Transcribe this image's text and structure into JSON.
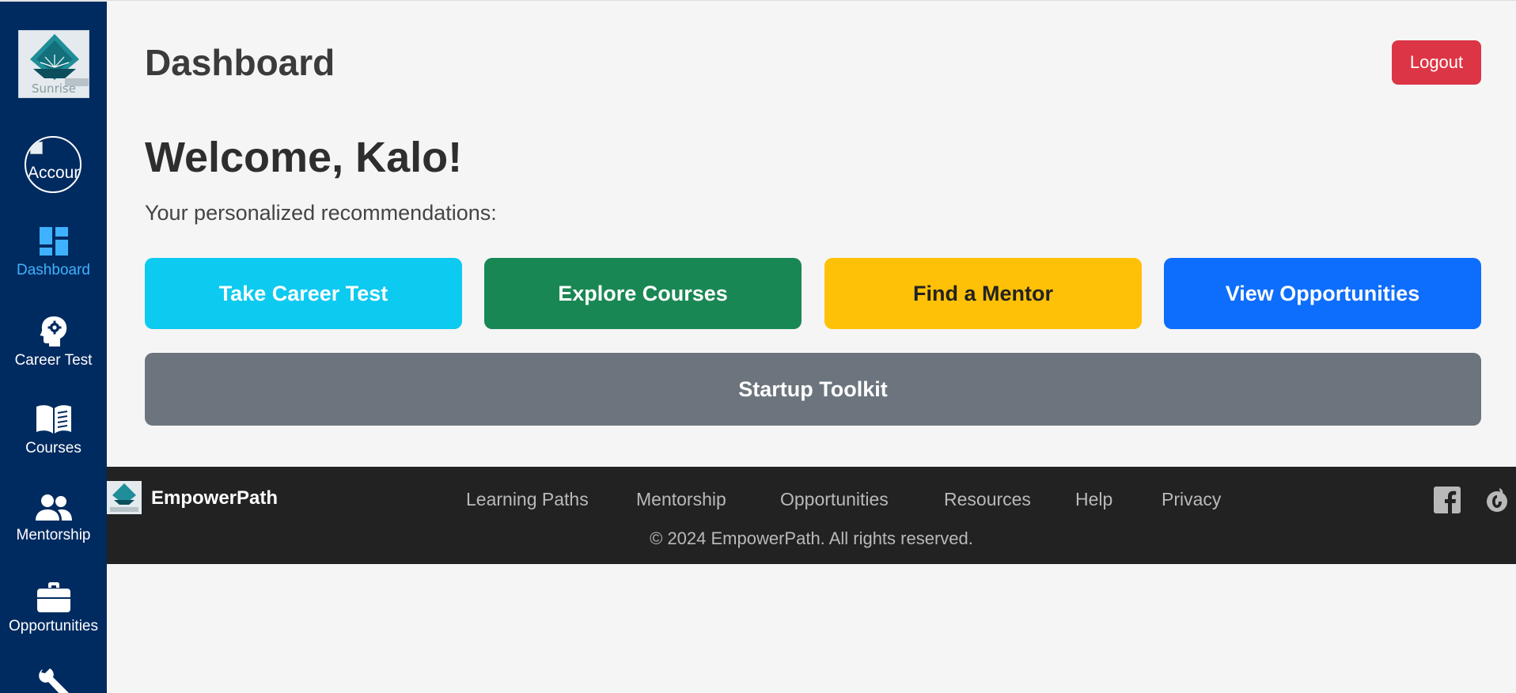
{
  "sidebar": {
    "logo_text": "Sunrise",
    "avatar_alt": "Account",
    "items": [
      {
        "label": "Dashboard",
        "icon": "dashboard-icon",
        "active": true
      },
      {
        "label": "Career Test",
        "icon": "head-gear-icon",
        "active": false
      },
      {
        "label": "Courses",
        "icon": "open-book-icon",
        "active": false
      },
      {
        "label": "Mentorship",
        "icon": "people-icon",
        "active": false
      },
      {
        "label": "Opportunities",
        "icon": "briefcase-icon",
        "active": false
      },
      {
        "label": "",
        "icon": "wrench-icon",
        "active": false
      }
    ],
    "active_color": "#3fb2ff",
    "background": "#002b60"
  },
  "header": {
    "title": "Dashboard",
    "logout_label": "Logout"
  },
  "main": {
    "welcome": "Welcome, Kalo!",
    "subtitle": "Your personalized recommendations:",
    "actions": [
      {
        "label": "Take Career Test",
        "color": "#0dcaf0"
      },
      {
        "label": "Explore Courses",
        "color": "#198754"
      },
      {
        "label": "Find a Mentor",
        "color": "#ffc107"
      },
      {
        "label": "View Opportunities",
        "color": "#0d6efd"
      },
      {
        "label": "Startup Toolkit",
        "color": "#6c757d"
      }
    ]
  },
  "footer": {
    "brand": "EmpowerPath",
    "links": [
      "Learning Paths",
      "Mentorship",
      "Opportunities",
      "Resources",
      "Help",
      "Privacy"
    ],
    "copyright": "© 2024 EmpowerPath. All rights reserved.",
    "social_icons": [
      "facebook-icon",
      "instagram-icon"
    ]
  }
}
